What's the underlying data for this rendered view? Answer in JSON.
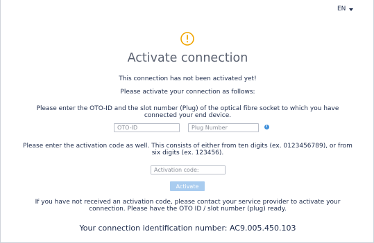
{
  "header": {
    "language": "EN"
  },
  "status_icon": "warning-circle-icon",
  "colors": {
    "warning": "#f0a500",
    "button_disabled": "#a9ccef",
    "info": "#3f8fd9",
    "text": "#1c2a4a"
  },
  "main": {
    "title": "Activate connection",
    "not_activated": "This connection has not been activated yet!",
    "instruction": "Please activate your connection as follows:",
    "oto_instruction_line1": "Please enter the OTO-ID and the slot number (Plug) of the optical fibre socket to which you have",
    "oto_instruction_line2": "connected your end device.",
    "oto_id_placeholder": "OTO-ID",
    "plug_number_placeholder": "Plug Number",
    "activation_instruction_line1": "Please enter the activation code as well. This consists of either from ten digits (ex. 0123456789), or from",
    "activation_instruction_line2": "six digits (ex. 123456).",
    "activation_code_placeholder": "Activation code:",
    "activate_button": "Activate",
    "no_code_line1": "If you have not received an activation code, please contact your service provider to activate your",
    "no_code_line2": "connection. Please have the OTO ID / slot number (plug) ready.",
    "connection_id_label": "Your connection identification number: AC9.005.450.103"
  }
}
